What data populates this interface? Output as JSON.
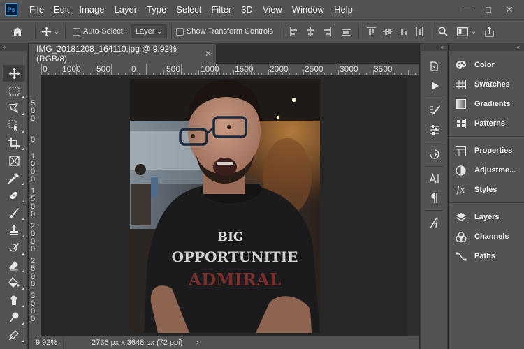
{
  "app": {
    "logo_text": "Ps"
  },
  "menu": [
    "File",
    "Edit",
    "Image",
    "Layer",
    "Type",
    "Select",
    "Filter",
    "3D",
    "View",
    "Window",
    "Help"
  ],
  "window_controls": {
    "minimize": "—",
    "maximize": "□",
    "close": "✕"
  },
  "options_bar": {
    "auto_select_label": "Auto-Select:",
    "auto_select_checked": false,
    "target_value": "Layer",
    "show_transform_label": "Show Transform Controls",
    "show_transform_checked": false
  },
  "document": {
    "tab_title": "IMG_20181208_164110.jpg @ 9.92% (RGB/8)",
    "close_glyph": "✕"
  },
  "ruler_h": [
    "0",
    "1000",
    "500",
    "0",
    "500",
    "1000",
    "1500",
    "2000",
    "2500",
    "3000",
    "3500"
  ],
  "ruler_v": [
    [
      "5",
      "0",
      "0"
    ],
    [
      "0"
    ],
    [
      "1",
      "0",
      "0",
      "0"
    ],
    [
      "1",
      "5",
      "0",
      "0"
    ],
    [
      "2",
      "0",
      "0",
      "0"
    ],
    [
      "2",
      "5",
      "0",
      "0"
    ],
    [
      "3",
      "0",
      "0",
      "0"
    ]
  ],
  "photo": {
    "shirt_line1": "BIG",
    "shirt_line2": "OPPORTUNITIE",
    "shirt_line3": "ADMIRAL"
  },
  "status": {
    "zoom": "9.92%",
    "info": "2736 px x 3648 px (72 ppi)",
    "arrow": "›"
  },
  "panels": {
    "group1": [
      "Color",
      "Swatches",
      "Gradients",
      "Patterns"
    ],
    "group2": [
      "Properties",
      "Adjustme...",
      "Styles"
    ],
    "group3": [
      "Layers",
      "Channels",
      "Paths"
    ]
  },
  "colors": {
    "chrome": "#535353",
    "canvas": "#282828",
    "ps_blue": "#31a8ff",
    "ps_dark": "#001e36"
  },
  "collapse_glyph": "»",
  "collapse_glyph_left": "«"
}
